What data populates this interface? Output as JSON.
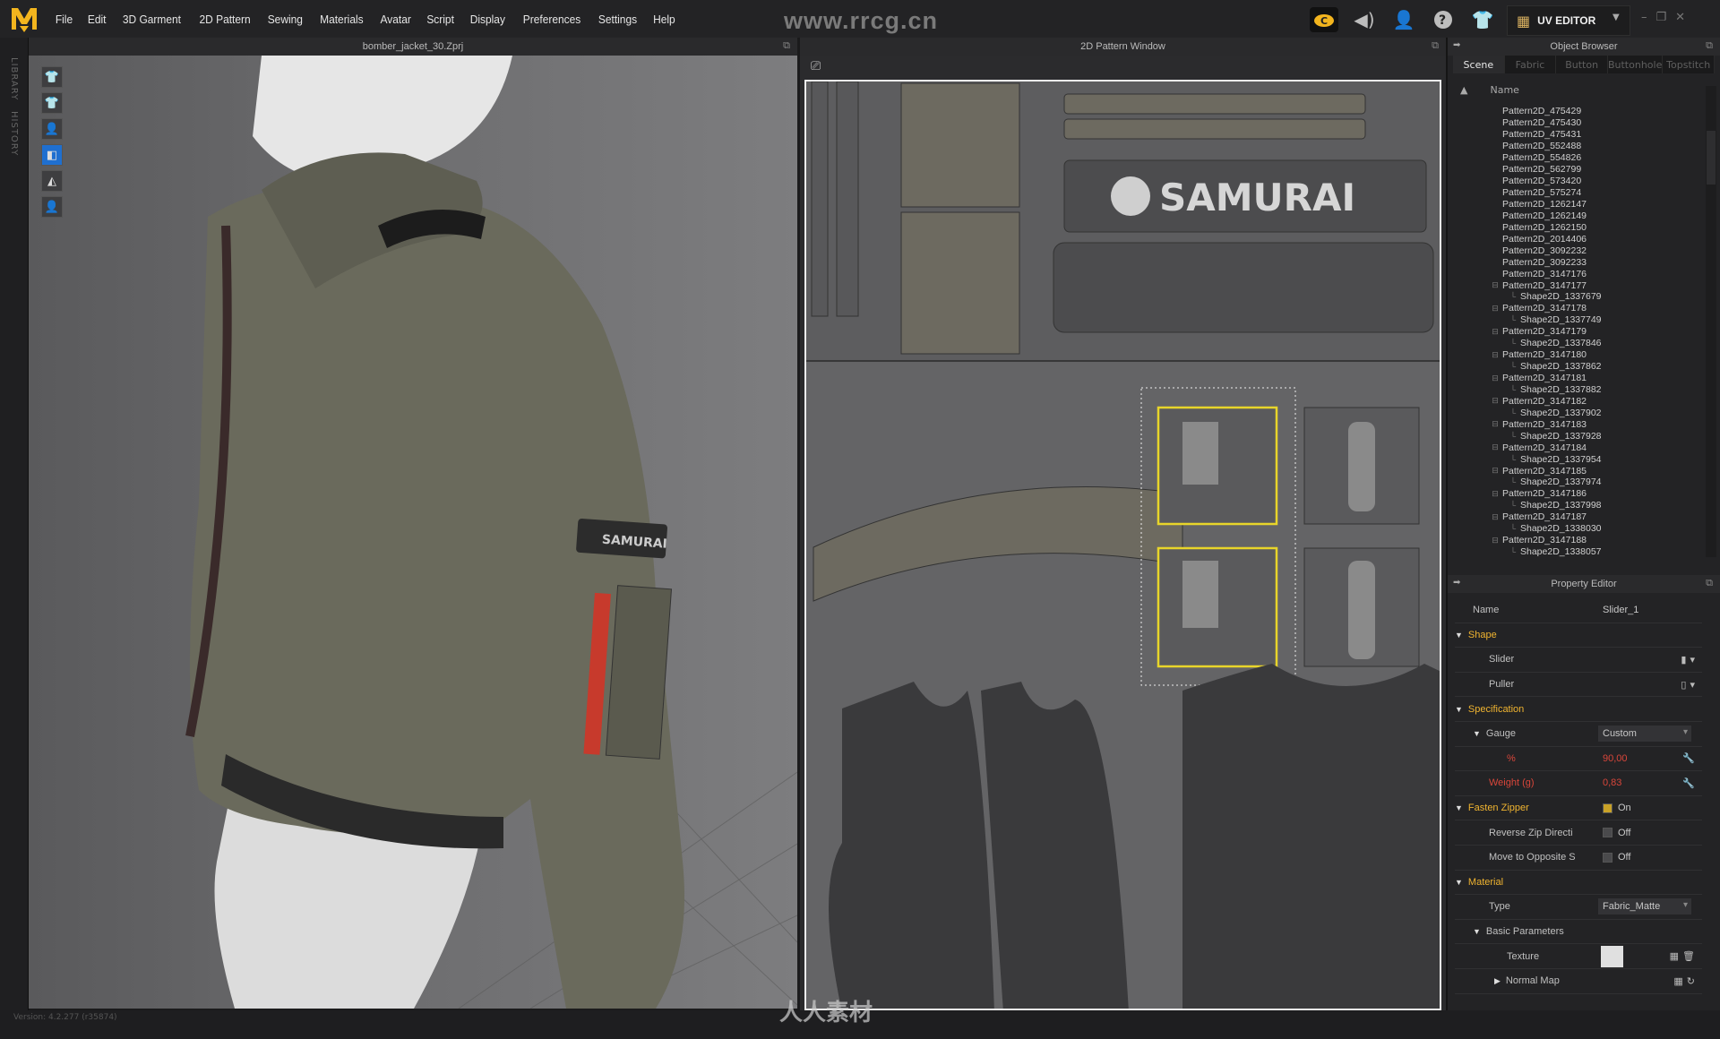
{
  "app": {
    "logo": "MD",
    "watermark_top": "www.rrcg.cn",
    "watermark_bottom": "人人素材",
    "version": "Version: 4.2.277 (r35874)"
  },
  "menu": [
    "File",
    "Edit",
    "3D Garment",
    "2D Pattern",
    "Sewing",
    "Materials",
    "Avatar",
    "Script",
    "Display",
    "Preferences",
    "Settings",
    "Help"
  ],
  "top_icons": [
    "cloud-icon",
    "speaker-icon",
    "user-icon",
    "help-icon",
    "add-garment-icon"
  ],
  "mode": {
    "label": "UV EDITOR"
  },
  "left_strip": [
    "LIBRARY",
    "HISTORY"
  ],
  "viewport": {
    "title": "bomber_jacket_30.Zprj",
    "tools": [
      "show-garment-icon",
      "show-garment-wire-icon",
      "show-avatar-icon",
      "texture-mode-icon",
      "shading-icon",
      "avatar-silhouette-icon"
    ],
    "patch_text": "SAMURAI"
  },
  "pattern_window": {
    "title": "2D Pattern Window",
    "label_text": "SAMURAI",
    "colors": {
      "selection": "#e8d52a",
      "canvas": "#646466"
    }
  },
  "object_browser": {
    "title": "Object Browser",
    "tabs": [
      "Scene",
      "Fabric",
      "Button",
      "Buttonhole",
      "Topstitch"
    ],
    "active_tab": "Scene",
    "column": "Name",
    "items": [
      {
        "label": "Pattern2D_475429",
        "level": 1
      },
      {
        "label": "Pattern2D_475430",
        "level": 1
      },
      {
        "label": "Pattern2D_475431",
        "level": 1
      },
      {
        "label": "Pattern2D_552488",
        "level": 1
      },
      {
        "label": "Pattern2D_554826",
        "level": 1
      },
      {
        "label": "Pattern2D_562799",
        "level": 1
      },
      {
        "label": "Pattern2D_573420",
        "level": 1
      },
      {
        "label": "Pattern2D_575274",
        "level": 1
      },
      {
        "label": "Pattern2D_1262147",
        "level": 1
      },
      {
        "label": "Pattern2D_1262149",
        "level": 1
      },
      {
        "label": "Pattern2D_1262150",
        "level": 1
      },
      {
        "label": "Pattern2D_2014406",
        "level": 1
      },
      {
        "label": "Pattern2D_3092232",
        "level": 1
      },
      {
        "label": "Pattern2D_3092233",
        "level": 1
      },
      {
        "label": "Pattern2D_3147176",
        "level": 1
      },
      {
        "label": "Pattern2D_3147177",
        "level": 1,
        "expanded": true
      },
      {
        "label": "Shape2D_1337679",
        "level": 2
      },
      {
        "label": "Pattern2D_3147178",
        "level": 1,
        "expanded": true
      },
      {
        "label": "Shape2D_1337749",
        "level": 2
      },
      {
        "label": "Pattern2D_3147179",
        "level": 1,
        "expanded": true
      },
      {
        "label": "Shape2D_1337846",
        "level": 2
      },
      {
        "label": "Pattern2D_3147180",
        "level": 1,
        "expanded": true
      },
      {
        "label": "Shape2D_1337862",
        "level": 2
      },
      {
        "label": "Pattern2D_3147181",
        "level": 1,
        "expanded": true
      },
      {
        "label": "Shape2D_1337882",
        "level": 2
      },
      {
        "label": "Pattern2D_3147182",
        "level": 1,
        "expanded": true
      },
      {
        "label": "Shape2D_1337902",
        "level": 2
      },
      {
        "label": "Pattern2D_3147183",
        "level": 1,
        "expanded": true
      },
      {
        "label": "Shape2D_1337928",
        "level": 2
      },
      {
        "label": "Pattern2D_3147184",
        "level": 1,
        "expanded": true
      },
      {
        "label": "Shape2D_1337954",
        "level": 2
      },
      {
        "label": "Pattern2D_3147185",
        "level": 1,
        "expanded": true
      },
      {
        "label": "Shape2D_1337974",
        "level": 2
      },
      {
        "label": "Pattern2D_3147186",
        "level": 1,
        "expanded": true
      },
      {
        "label": "Shape2D_1337998",
        "level": 2
      },
      {
        "label": "Pattern2D_3147187",
        "level": 1,
        "expanded": true
      },
      {
        "label": "Shape2D_1338030",
        "level": 2
      },
      {
        "label": "Pattern2D_3147188",
        "level": 1,
        "expanded": true
      },
      {
        "label": "Shape2D_1338057",
        "level": 2
      }
    ]
  },
  "property_editor": {
    "title": "Property Editor",
    "name_label": "Name",
    "name_value": "Slider_1",
    "shape": {
      "label": "Shape",
      "slider": "Slider",
      "puller": "Puller"
    },
    "spec": {
      "label": "Specification",
      "gauge": "Gauge",
      "gauge_value": "Custom",
      "pct_label": "%",
      "pct_value": "90,00",
      "weight_label": "Weight (g)",
      "weight_value": "0,83"
    },
    "fasten": {
      "label": "Fasten Zipper",
      "value": "On",
      "checked": true,
      "reverse_label": "Reverse Zip Directi",
      "reverse_value": "Off",
      "move_label": "Move to Opposite S",
      "move_value": "Off"
    },
    "material": {
      "label": "Material",
      "type_label": "Type",
      "type_value": "Fabric_Matte",
      "basic": "Basic Parameters",
      "texture": "Texture",
      "normal": "Normal Map"
    }
  }
}
